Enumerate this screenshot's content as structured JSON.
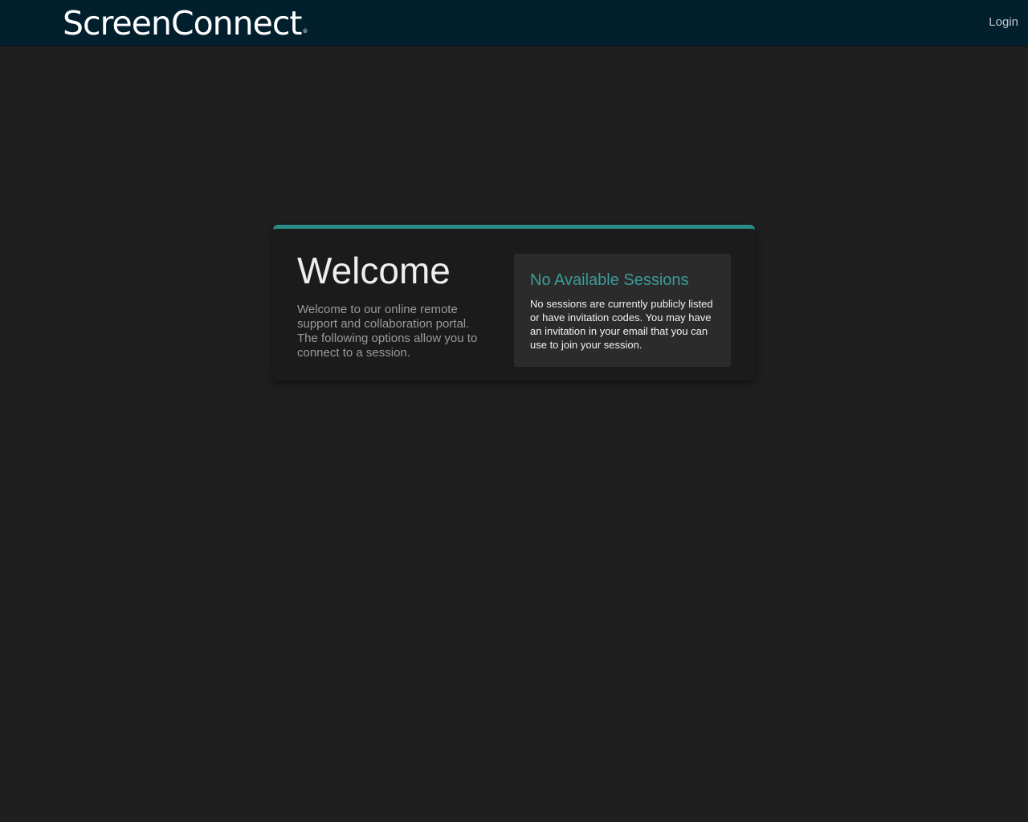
{
  "header": {
    "logo_text": "ScreenConnect",
    "logo_mark": "®",
    "login_label": "Login"
  },
  "welcome": {
    "title": "Welcome",
    "description": "Welcome to our online remote support and collaboration portal. The following options allow you to connect to a session."
  },
  "sessions": {
    "title": "No Available Sessions",
    "message": "No sessions are currently publicly listed or have invitation codes. You may have an invitation in your email that you can use to join your session."
  },
  "colors": {
    "accent": "#2b8c8a",
    "header_bg": "#021f2e",
    "page_bg": "#1f1f1f"
  }
}
